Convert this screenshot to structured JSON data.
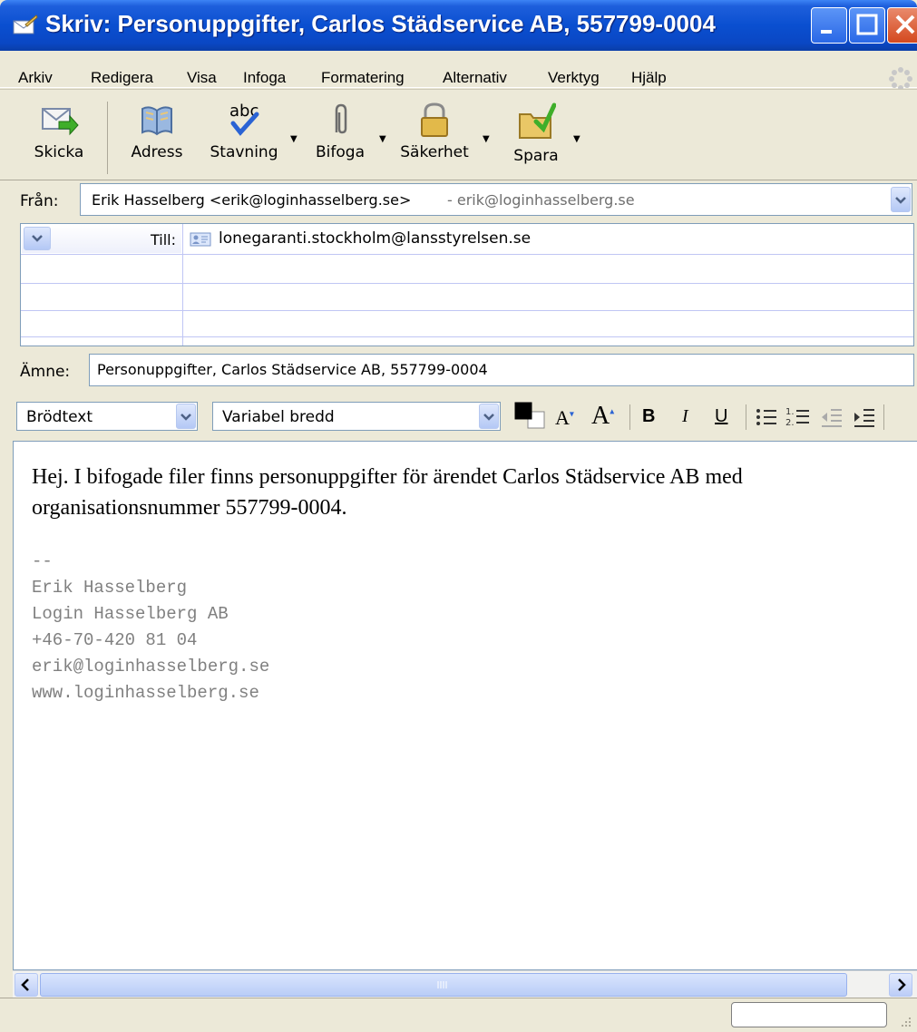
{
  "window": {
    "title": "Skriv: Personuppgifter, Carlos Städservice AB, 557799-0004"
  },
  "menu": {
    "items": [
      "Arkiv",
      "Redigera",
      "Visa",
      "Infoga",
      "Formatering",
      "Alternativ",
      "Verktyg",
      "Hjälp"
    ]
  },
  "toolbar": {
    "send": "Skicka",
    "address": "Adress",
    "spelling": "Stavning",
    "attach": "Bifoga",
    "security": "Säkerhet",
    "save": "Spara"
  },
  "header": {
    "from_label": "Från:",
    "from_value": "Erik Hasselberg <erik@loginhasselberg.se>",
    "from_account": "- erik@loginhasselberg.se",
    "to_label": "Till:",
    "to_value": "lonegaranti.stockholm@lansstyrelsen.se",
    "subject_label": "Ämne:",
    "subject_value": "Personuppgifter, Carlos Städservice AB, 557799-0004"
  },
  "format": {
    "paragraph_style": "Brödtext",
    "font": "Variabel bredd",
    "text_color": "#000000",
    "bold": "B",
    "italic": "I",
    "underline": "U"
  },
  "message": {
    "body": "Hej. I bifogade filer finns personuppgifter för ärendet Carlos Städservice AB med organisationsnummer 557799-0004.",
    "signature": {
      "separator": "--",
      "name": "Erik Hasselberg",
      "company": "Login Hasselberg AB",
      "phone": "+46-70-420 81 04",
      "email": "erik@loginhasselberg.se",
      "web": "www.loginhasselberg.se"
    }
  },
  "colors": {
    "titlebar": "#0a4fd0",
    "chrome": "#ece9d8",
    "signature_text": "#808080"
  }
}
